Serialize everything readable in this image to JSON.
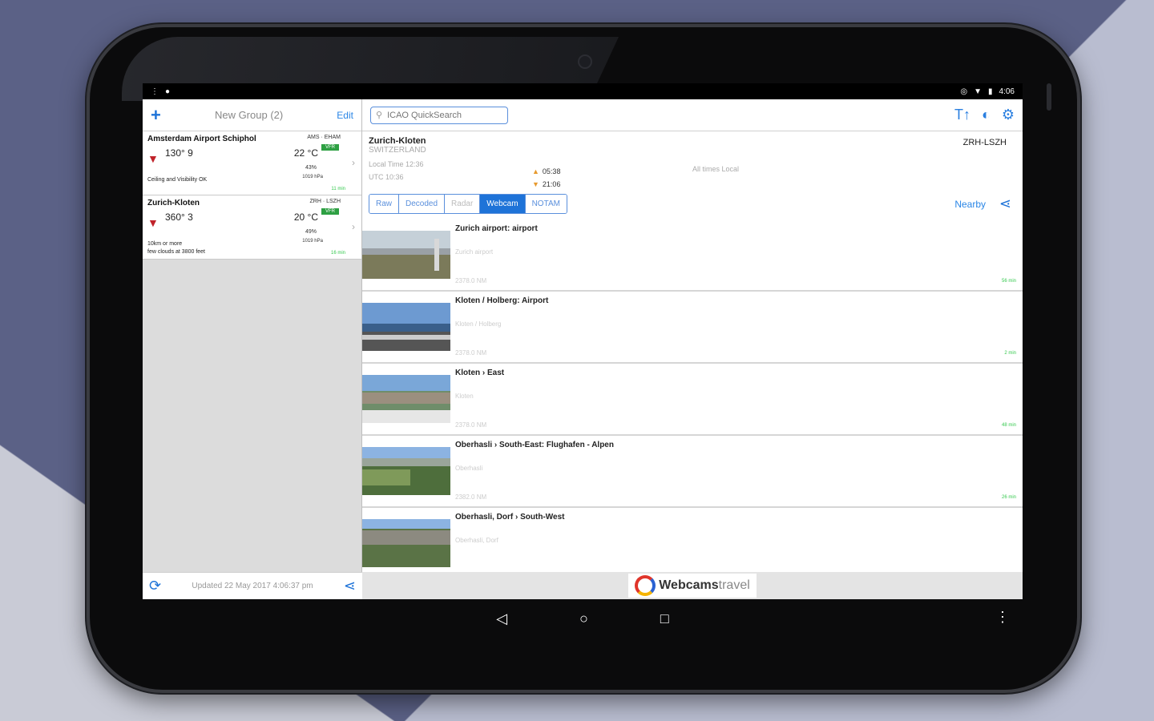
{
  "statusbar": {
    "left_icons": [
      "more-icon",
      "location-icon"
    ],
    "time": "4:06"
  },
  "left_pane": {
    "header": {
      "add": "+",
      "title": "New Group (2)",
      "edit": "Edit"
    },
    "airports": [
      {
        "name": "Amsterdam Airport Schiphol",
        "codes": "AMS · EHAM",
        "badge": "VFR",
        "wind": "130° 9",
        "temp": "22 °C",
        "humidity": "43%",
        "pressure": "1019 hPa",
        "note1": "Ceiling and Visibility OK",
        "note2": "",
        "age": "11 min"
      },
      {
        "name": "Zurich-Kloten",
        "codes": "ZRH · LSZH",
        "badge": "VFR",
        "wind": "360° 3",
        "temp": "20 °C",
        "humidity": "49%",
        "pressure": "1019 hPa",
        "note1": "10km or more",
        "note2": "few clouds at 3800 feet",
        "age": "16 min"
      }
    ],
    "footer": {
      "updated": "Updated 22 May 2017 4:06:37 pm"
    }
  },
  "right_pane": {
    "search": {
      "placeholder": "ICAO QuickSearch"
    },
    "tools": [
      "text-size-icon",
      "contrast-icon",
      "settings-icon"
    ],
    "info": {
      "city": "Zurich-Kloten",
      "country": "SWITZERLAND",
      "local_time": "Local Time 12:36",
      "utc": "UTC 10:36",
      "sunrise": "05:38",
      "sunset": "21:06",
      "all_times": "All times Local",
      "codes": "ZRH-LSZH"
    },
    "tabs": [
      {
        "label": "Raw",
        "state": "normal"
      },
      {
        "label": "Decoded",
        "state": "normal"
      },
      {
        "label": "Radar",
        "state": "dim"
      },
      {
        "label": "Webcam",
        "state": "active"
      },
      {
        "label": "NOTAM",
        "state": "normal"
      }
    ],
    "nearby": "Nearby",
    "webcams": [
      {
        "title": "Zurich airport: airport",
        "sub": "Zurich airport",
        "dist": "2378.0 NM",
        "age": "56 min"
      },
      {
        "title": "Kloten / Holberg: Airport",
        "sub": "Kloten / Holberg",
        "dist": "2378.0 NM",
        "age": "2 min"
      },
      {
        "title": "Kloten › East",
        "sub": "Kloten",
        "dist": "2378.0 NM",
        "age": "48 min"
      },
      {
        "title": "Oberhasli › South-East: Flughafen - Alpen",
        "sub": "Oberhasli",
        "dist": "2382.0 NM",
        "age": "26 min"
      },
      {
        "title": "Oberhasli, Dorf › South-West",
        "sub": "Oberhasli, Dorf",
        "dist": "",
        "age": ""
      }
    ],
    "provider": {
      "brand": "Webcams",
      "suffix": "travel"
    }
  },
  "navbar": {
    "back": "◁",
    "home": "○",
    "recents": "□"
  }
}
